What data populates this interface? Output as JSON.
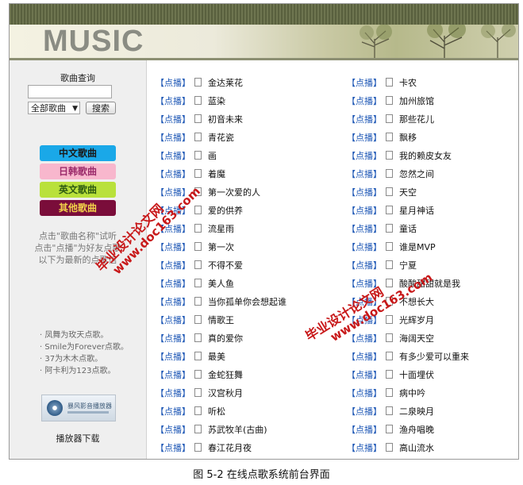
{
  "banner": {
    "logo": "MUSIC"
  },
  "sidebar": {
    "search_title": "歌曲查询",
    "search_value": "",
    "select_value": "全部歌曲",
    "search_button": "搜索",
    "categories": [
      {
        "label": "中文歌曲",
        "bg": "#1aa8e8",
        "color": "#1a1a1a"
      },
      {
        "label": "日韩歌曲",
        "bg": "#f8b7cd",
        "color": "#9b2a6a"
      },
      {
        "label": "英文歌曲",
        "bg": "#b9e13b",
        "color": "#2d5a12"
      },
      {
        "label": "其他歌曲",
        "bg": "#7a0d3a",
        "color": "#f2d24a"
      }
    ],
    "notes": [
      "点击\"歌曲名称\"试听",
      "点击\"点播\"为好友点歌",
      "以下为最新的点歌信"
    ],
    "dedications": [
      "· 凤舞为玫天点歌。",
      "· Smile为Forever点歌。",
      "· 37为木木点歌。",
      "· 阿卡利为123点歌。"
    ],
    "player_text": "暴风影音播放器",
    "download_label": "播放器下载"
  },
  "play_label": "【点播】",
  "songs_left": [
    "金达莱花",
    "蓝染",
    "初音未来",
    "青花瓷",
    "画",
    "着魔",
    "第一次爱的人",
    "爱的供养",
    "流星雨",
    "第一次",
    "不得不爱",
    "美人鱼",
    "当你孤单你会想起谁",
    "情歌王",
    "真的爱你",
    "最美",
    "金蛇狂舞",
    "汉宫秋月",
    "听松",
    "苏武牧羊(古曲)",
    "春江花月夜"
  ],
  "songs_right": [
    "卡农",
    "加州旅馆",
    "那些花儿",
    "飘移",
    "我的赖皮女友",
    "忽然之间",
    "天空",
    "星月神话",
    "童话",
    "谁是MVP",
    "宁夏",
    "酸酸甜甜就是我",
    "不想长大",
    "光辉岁月",
    "海阔天空",
    "有多少爱可以重来",
    "十面埋伏",
    "病中吟",
    "二泉映月",
    "渔舟唱晚",
    "高山流水"
  ],
  "watermarks": [
    {
      "line1": "毕业设计论文网",
      "line2": "www.doc163.com"
    },
    {
      "line1": "毕业设计论文网",
      "line2": "www.doc163.com"
    }
  ],
  "caption": "图 5-2  在线点歌系统前台界面"
}
